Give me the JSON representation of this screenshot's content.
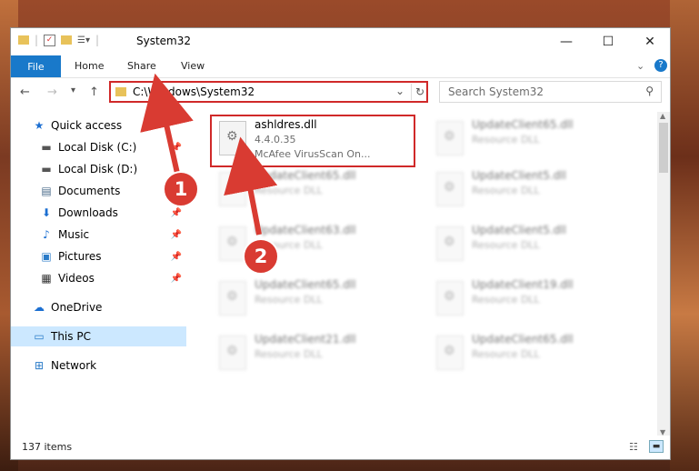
{
  "window": {
    "title": "System32"
  },
  "ribbon": {
    "file": "File",
    "tabs": [
      "Home",
      "Share",
      "View"
    ]
  },
  "address": {
    "path": "C:\\Windows\\System32"
  },
  "search": {
    "placeholder": "Search System32"
  },
  "sidebar": {
    "items": [
      {
        "label": "Quick access",
        "icon": "star-icon"
      },
      {
        "label": "Local Disk (C:)",
        "icon": "disk-icon"
      },
      {
        "label": "Local Disk (D:)",
        "icon": "disk-icon"
      },
      {
        "label": "Documents",
        "icon": "documents-icon"
      },
      {
        "label": "Downloads",
        "icon": "download-icon"
      },
      {
        "label": "Music",
        "icon": "music-icon"
      },
      {
        "label": "Pictures",
        "icon": "pictures-icon"
      },
      {
        "label": "Videos",
        "icon": "videos-icon"
      },
      {
        "label": "OneDrive",
        "icon": "cloud-icon"
      },
      {
        "label": "This PC",
        "icon": "pc-icon"
      },
      {
        "label": "Network",
        "icon": "network-icon"
      }
    ]
  },
  "files": {
    "left": [
      {
        "name": "ashldres.dll",
        "line2": "4.4.0.35",
        "line3": "McAfee VirusScan On..."
      },
      {
        "name": "UpdateClient65.dll",
        "line2": "Resource DLL"
      },
      {
        "name": "UpdateClient63.dll",
        "line2": "Resource DLL"
      },
      {
        "name": "UpdateClient65.dll",
        "line2": "Resource DLL"
      },
      {
        "name": "UpdateClient21.dll",
        "line2": "Resource DLL"
      }
    ],
    "right": [
      {
        "name": "UpdateClient65.dll",
        "line2": "Resource DLL"
      },
      {
        "name": "UpdateClient5.dll",
        "line2": "Resource DLL"
      },
      {
        "name": "UpdateClient5.dll",
        "line2": "Resource DLL"
      },
      {
        "name": "UpdateClient19.dll",
        "line2": "Resource DLL"
      },
      {
        "name": "UpdateClient65.dll",
        "line2": "Resource DLL"
      }
    ]
  },
  "status": {
    "count": "137 items"
  },
  "annotations": {
    "badge1": "1",
    "badge2": "2",
    "color": "#d93b32"
  }
}
